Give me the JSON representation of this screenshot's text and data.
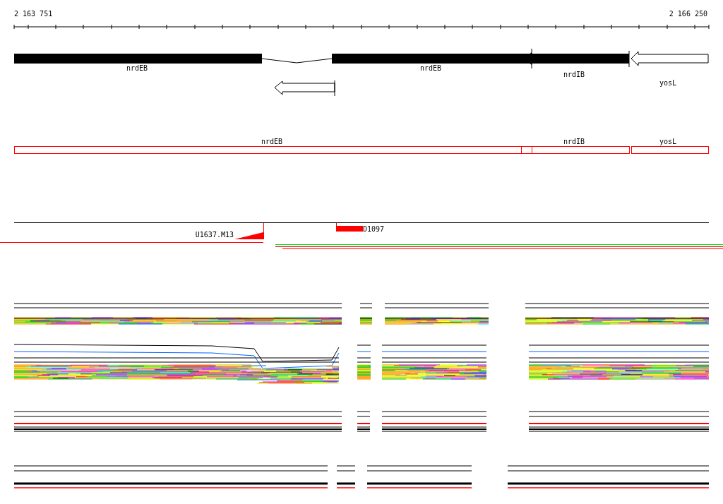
{
  "ruler": {
    "start": "2 163 751",
    "end": "2 166 250"
  },
  "genes": [
    {
      "label": "nrdEB"
    },
    {
      "label": "nrdEB"
    },
    {
      "label": "nrdIB"
    },
    {
      "label": "yosL"
    }
  ],
  "annotations": [
    {
      "label": "nrdEB"
    },
    {
      "label": "nrdIB"
    },
    {
      "label": "yosL"
    }
  ],
  "reads": [
    {
      "label": "U1637.M13"
    },
    {
      "label": "D1097"
    }
  ]
}
